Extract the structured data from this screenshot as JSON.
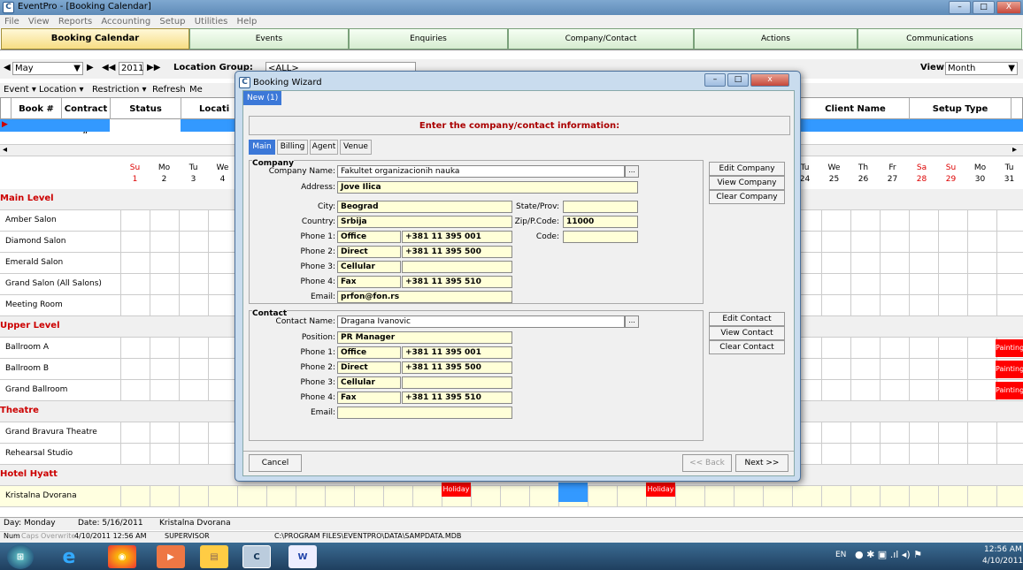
{
  "window": {
    "title": "EventPro - [Booking Calendar]"
  },
  "menu": [
    "File",
    "View",
    "Reports",
    "Accounting",
    "Setup",
    "Utilities",
    "Help"
  ],
  "tabs": [
    "Booking Calendar",
    "Events",
    "Enquiries",
    "Company/Contact",
    "Actions",
    "Communications"
  ],
  "toolbar": {
    "month": "May",
    "year": "2011",
    "location_group_label": "Location Group:",
    "location_group_value": "<ALL>",
    "view_label": "View:",
    "view_value": "Month"
  },
  "toolbar2": [
    "Event",
    "Location",
    "Restriction",
    "Refresh",
    "Me"
  ],
  "grid": {
    "headers": [
      "Book #",
      "Contract #",
      "Status",
      "Locati",
      "Client Name",
      "Setup Type"
    ]
  },
  "calendar": {
    "day_headers_left": [
      {
        "d": "Su",
        "n": "1",
        "red": true
      },
      {
        "d": "Mo",
        "n": "2"
      },
      {
        "d": "Tu",
        "n": "3"
      },
      {
        "d": "We",
        "n": "4"
      }
    ],
    "day_headers_right": [
      {
        "d": "Tu",
        "n": "24"
      },
      {
        "d": "We",
        "n": "25"
      },
      {
        "d": "Th",
        "n": "26"
      },
      {
        "d": "Fr",
        "n": "27"
      },
      {
        "d": "Sa",
        "n": "28",
        "red": true
      },
      {
        "d": "Su",
        "n": "29",
        "red": true
      },
      {
        "d": "Mo",
        "n": "30"
      },
      {
        "d": "Tu",
        "n": "31"
      }
    ],
    "rows": [
      {
        "label": "Main Level",
        "section": true
      },
      {
        "label": "Amber Salon"
      },
      {
        "label": "Diamond Salon"
      },
      {
        "label": "Emerald Salon"
      },
      {
        "label": "Grand Salon (All Salons)"
      },
      {
        "label": "Meeting Room"
      },
      {
        "label": "Upper Level",
        "section": true
      },
      {
        "label": "Ballroom A",
        "painting": "Painting"
      },
      {
        "label": "Ballroom B",
        "painting": "Painting"
      },
      {
        "label": "Grand Ballroom",
        "painting": "Painting"
      },
      {
        "label": "Theatre",
        "section": true
      },
      {
        "label": "Grand Bravura Theatre"
      },
      {
        "label": "Rehearsal Studio"
      },
      {
        "label": "Hotel Hyatt",
        "section": true
      },
      {
        "label": "Kristalna Dvorana",
        "yellow": true
      }
    ],
    "holiday_label": "Holiday"
  },
  "status": {
    "day": "Day: Monday",
    "date": "Date: 5/16/2011",
    "room": "Kristalna Dvorana"
  },
  "status2": {
    "num": "Num",
    "caps": "Caps",
    "overwrite": "Overwrite",
    "datetime": "4/10/2011 12:56 AM",
    "user": "SUPERVISOR",
    "path": "C:\\PROGRAM FILES\\EVENTPRO\\DATA\\SAMPDATA.MDB"
  },
  "taskbar": {
    "lang": "EN",
    "time": "12:56 AM",
    "date": "4/10/2011"
  },
  "wizard": {
    "title": "Booking Wizard",
    "new_tab": "New (1)",
    "message": "Enter the company/contact information:",
    "tabs": [
      "Main",
      "Billing",
      "Agent",
      "Venue"
    ],
    "company": {
      "group": "Company",
      "name_label": "Company Name:",
      "name": "Fakultet organizacionih nauka",
      "address_label": "Address:",
      "address": "Jove Ilica",
      "city_label": "City:",
      "city": "Beograd",
      "country_label": "Country:",
      "country": "Srbija",
      "state_label": "State/Prov:",
      "state": "",
      "zip_label": "Zip/P.Code:",
      "zip": "11000",
      "code_label": "Code:",
      "code": "",
      "phones": [
        {
          "label": "Phone 1:",
          "type": "Office",
          "num": "+381 11 395 001"
        },
        {
          "label": "Phone 2:",
          "type": "Direct",
          "num": "+381 11 395 500"
        },
        {
          "label": "Phone 3:",
          "type": "Cellular",
          "num": ""
        },
        {
          "label": "Phone 4:",
          "type": "Fax",
          "num": "+381 11 395 510"
        }
      ],
      "email_label": "Email:",
      "email": "prfon@fon.rs",
      "buttons": [
        "Edit Company",
        "View Company",
        "Clear Company"
      ]
    },
    "contact": {
      "group": "Contact",
      "name_label": "Contact Name:",
      "name": "Dragana  Ivanovic",
      "position_label": "Position:",
      "position": "PR Manager",
      "phones": [
        {
          "label": "Phone 1:",
          "type": "Office",
          "num": "+381 11 395 001"
        },
        {
          "label": "Phone 2:",
          "type": "Direct",
          "num": "+381 11 395 500"
        },
        {
          "label": "Phone 3:",
          "type": "Cellular",
          "num": ""
        },
        {
          "label": "Phone 4:",
          "type": "Fax",
          "num": "+381 11 395 510"
        }
      ],
      "email_label": "Email:",
      "email": "",
      "buttons": [
        "Edit Contact",
        "View Contact",
        "Clear Contact"
      ]
    },
    "cancel": "Cancel",
    "back": "<< Back",
    "next": "Next >>"
  }
}
